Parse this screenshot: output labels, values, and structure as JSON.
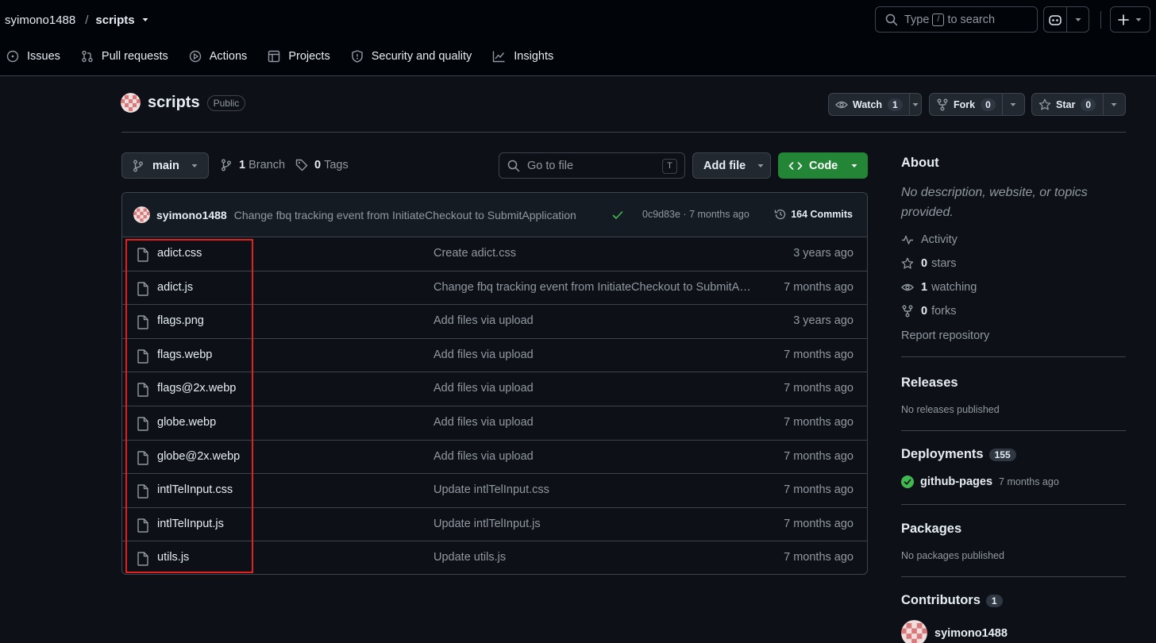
{
  "header": {
    "owner": "syimono1488",
    "separator": "/",
    "repo": "scripts",
    "search_prefix": "Type",
    "search_key": "/",
    "search_suffix": "to search"
  },
  "nav": [
    {
      "label": "Issues",
      "icon": "issue-icon"
    },
    {
      "label": "Pull requests",
      "icon": "pull-request-icon"
    },
    {
      "label": "Actions",
      "icon": "play-icon"
    },
    {
      "label": "Projects",
      "icon": "table-icon"
    },
    {
      "label": "Security and quality",
      "icon": "shield-icon"
    },
    {
      "label": "Insights",
      "icon": "graph-icon"
    }
  ],
  "repo": {
    "name": "scripts",
    "visibility": "Public",
    "watch_label": "Watch",
    "watch_count": "1",
    "fork_label": "Fork",
    "fork_count": "0",
    "star_label": "Star",
    "star_count": "0"
  },
  "toolbar": {
    "branch": "main",
    "branch_count": "1",
    "branch_label": "Branch",
    "tag_count": "0",
    "tag_label": "Tags",
    "goto_placeholder": "Go to file",
    "goto_key": "T",
    "add_file": "Add file",
    "code": "Code"
  },
  "commit": {
    "author": "syimono1488",
    "message": "Change fbq tracking event from InitiateCheckout to SubmitApplication",
    "sha_time": "0c9d83e · 7 months ago",
    "commits": "164 Commits"
  },
  "files": [
    {
      "name": "adict.css",
      "message": "Create adict.css",
      "date": "3 years ago"
    },
    {
      "name": "adict.js",
      "message": "Change fbq tracking event from InitiateCheckout to SubmitApplication",
      "date": "7 months ago"
    },
    {
      "name": "flags.png",
      "message": "Add files via upload",
      "date": "3 years ago"
    },
    {
      "name": "flags.webp",
      "message": "Add files via upload",
      "date": "7 months ago"
    },
    {
      "name": "flags@2x.webp",
      "message": "Add files via upload",
      "date": "7 months ago"
    },
    {
      "name": "globe.webp",
      "message": "Add files via upload",
      "date": "7 months ago"
    },
    {
      "name": "globe@2x.webp",
      "message": "Add files via upload",
      "date": "7 months ago"
    },
    {
      "name": "intlTelInput.css",
      "message": "Update intlTelInput.css",
      "date": "7 months ago"
    },
    {
      "name": "intlTelInput.js",
      "message": "Update intlTelInput.js",
      "date": "7 months ago"
    },
    {
      "name": "utils.js",
      "message": "Update utils.js",
      "date": "7 months ago"
    }
  ],
  "about": {
    "title": "About",
    "description": "No description, website, or topics provided.",
    "activity": "Activity",
    "stars_count": "0",
    "stars_label": "stars",
    "watching_count": "1",
    "watching_label": "watching",
    "forks_count": "0",
    "forks_label": "forks",
    "report": "Report repository"
  },
  "releases": {
    "title": "Releases",
    "empty": "No releases published"
  },
  "deployments": {
    "title": "Deployments",
    "count": "155",
    "env": "github-pages",
    "time": "7 months ago"
  },
  "packages": {
    "title": "Packages",
    "empty": "No packages published"
  },
  "contributors": {
    "title": "Contributors",
    "count": "1",
    "user": "syimono1488"
  },
  "colors": {
    "accent_green": "#238636",
    "highlight_red": "#e0201c",
    "background": "#0d1117",
    "header_bg": "#010409"
  }
}
